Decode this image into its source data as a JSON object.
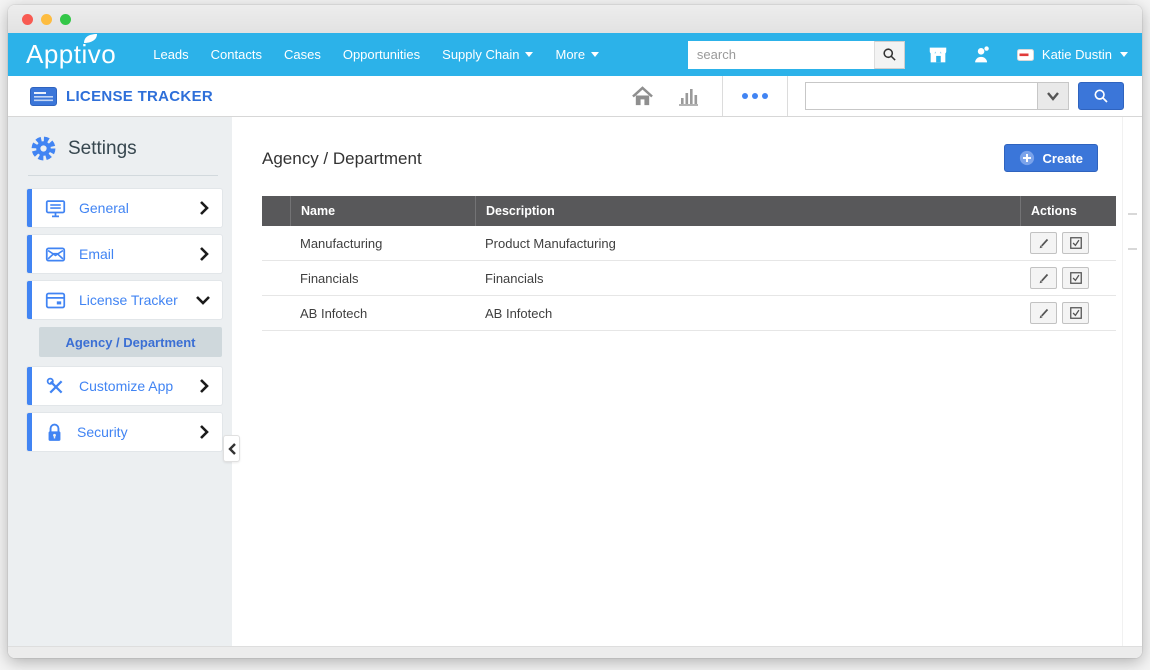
{
  "navbar": {
    "logo": "Apptivo",
    "menu": [
      "Leads",
      "Contacts",
      "Cases",
      "Opportunities"
    ],
    "dropdown_menu": [
      "Supply Chain",
      "More"
    ],
    "search_placeholder": "search",
    "user_name": "Katie Dustin"
  },
  "app_header": {
    "title": "LICENSE TRACKER",
    "toolbar_search_value": ""
  },
  "sidebar": {
    "title": "Settings",
    "items": [
      {
        "label": "General"
      },
      {
        "label": "Email"
      },
      {
        "label": "License Tracker"
      },
      {
        "label": "Customize App"
      },
      {
        "label": "Security"
      }
    ],
    "active_subitem": "Agency / Department"
  },
  "main": {
    "title": "Agency / Department",
    "create_label": "Create",
    "table": {
      "headers": [
        "Name",
        "Description",
        "Actions"
      ],
      "rows": [
        {
          "name": "Manufacturing",
          "description": "Product Manufacturing"
        },
        {
          "name": "Financials",
          "description": "Financials"
        },
        {
          "name": "AB Infotech",
          "description": "AB Infotech"
        }
      ]
    }
  },
  "colors": {
    "navbar_blue": "#2cb2e9",
    "accent_blue": "#4184f3",
    "button_blue": "#3b76d9",
    "title_blue": "#2e6fd9",
    "table_header_gray": "#58585a",
    "sidebar_bg": "#eceff1",
    "active_item_bg": "#cfd8dc"
  }
}
